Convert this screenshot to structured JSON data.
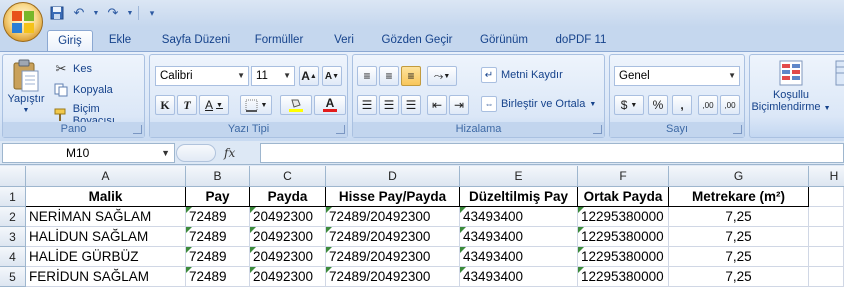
{
  "tabs": [
    "Giriş",
    "Ekle",
    "Sayfa Düzeni",
    "Formüller",
    "Veri",
    "Gözden Geçir",
    "Görünüm",
    "doPDF 11"
  ],
  "ribbon": {
    "pano": {
      "label": "Pano",
      "paste": "Yapıştır",
      "cut": "Kes",
      "copy": "Kopyala",
      "format_painter": "Biçim Boyacısı"
    },
    "font": {
      "label": "Yazı Tipi",
      "name": "Calibri",
      "size": "11",
      "grow": "A",
      "shrink": "A",
      "bold": "K",
      "italic": "T",
      "underline": "A",
      "font_color_glyph": "A"
    },
    "alignment": {
      "label": "Hizalama",
      "wrap_text": "Metni Kaydır",
      "merge_center": "Birleştir ve Ortala"
    },
    "number": {
      "label": "Sayı",
      "format": "Genel",
      "currency": "$",
      "percent": "%",
      "comma": ",",
      "increase_decimal": ",00",
      "decrease_decimal": ",00"
    },
    "styles": {
      "conditional_formatting_line1": "Koşullu",
      "conditional_formatting_line2": "Biçimlendirme"
    }
  },
  "formula_bar": {
    "cell_ref": "M10",
    "fx": "fx",
    "content": ""
  },
  "sheet": {
    "columns": [
      "A",
      "B",
      "C",
      "D",
      "E",
      "F",
      "G",
      "H"
    ],
    "rows": [
      "1",
      "2",
      "3",
      "4",
      "5"
    ],
    "header_row": [
      "Malik",
      "Pay",
      "Payda",
      "Hisse Pay/Payda",
      "Düzeltilmiş Pay",
      "Ortak Payda",
      "Metrekare (m²)"
    ],
    "data": [
      [
        "NERİMAN SAĞLAM",
        "72489",
        "20492300",
        "72489/20492300",
        "43493400",
        "12295380000",
        "7,25"
      ],
      [
        "HALİDUN SAĞLAM",
        "72489",
        "20492300",
        "72489/20492300",
        "43493400",
        "12295380000",
        "7,25"
      ],
      [
        "HALİDE GÜRBÜZ",
        "72489",
        "20492300",
        "72489/20492300",
        "43493400",
        "12295380000",
        "7,25"
      ],
      [
        "FERİDUN SAĞLAM",
        "72489",
        "20492300",
        "72489/20492300",
        "43493400",
        "12295380000",
        "7,25"
      ]
    ]
  }
}
